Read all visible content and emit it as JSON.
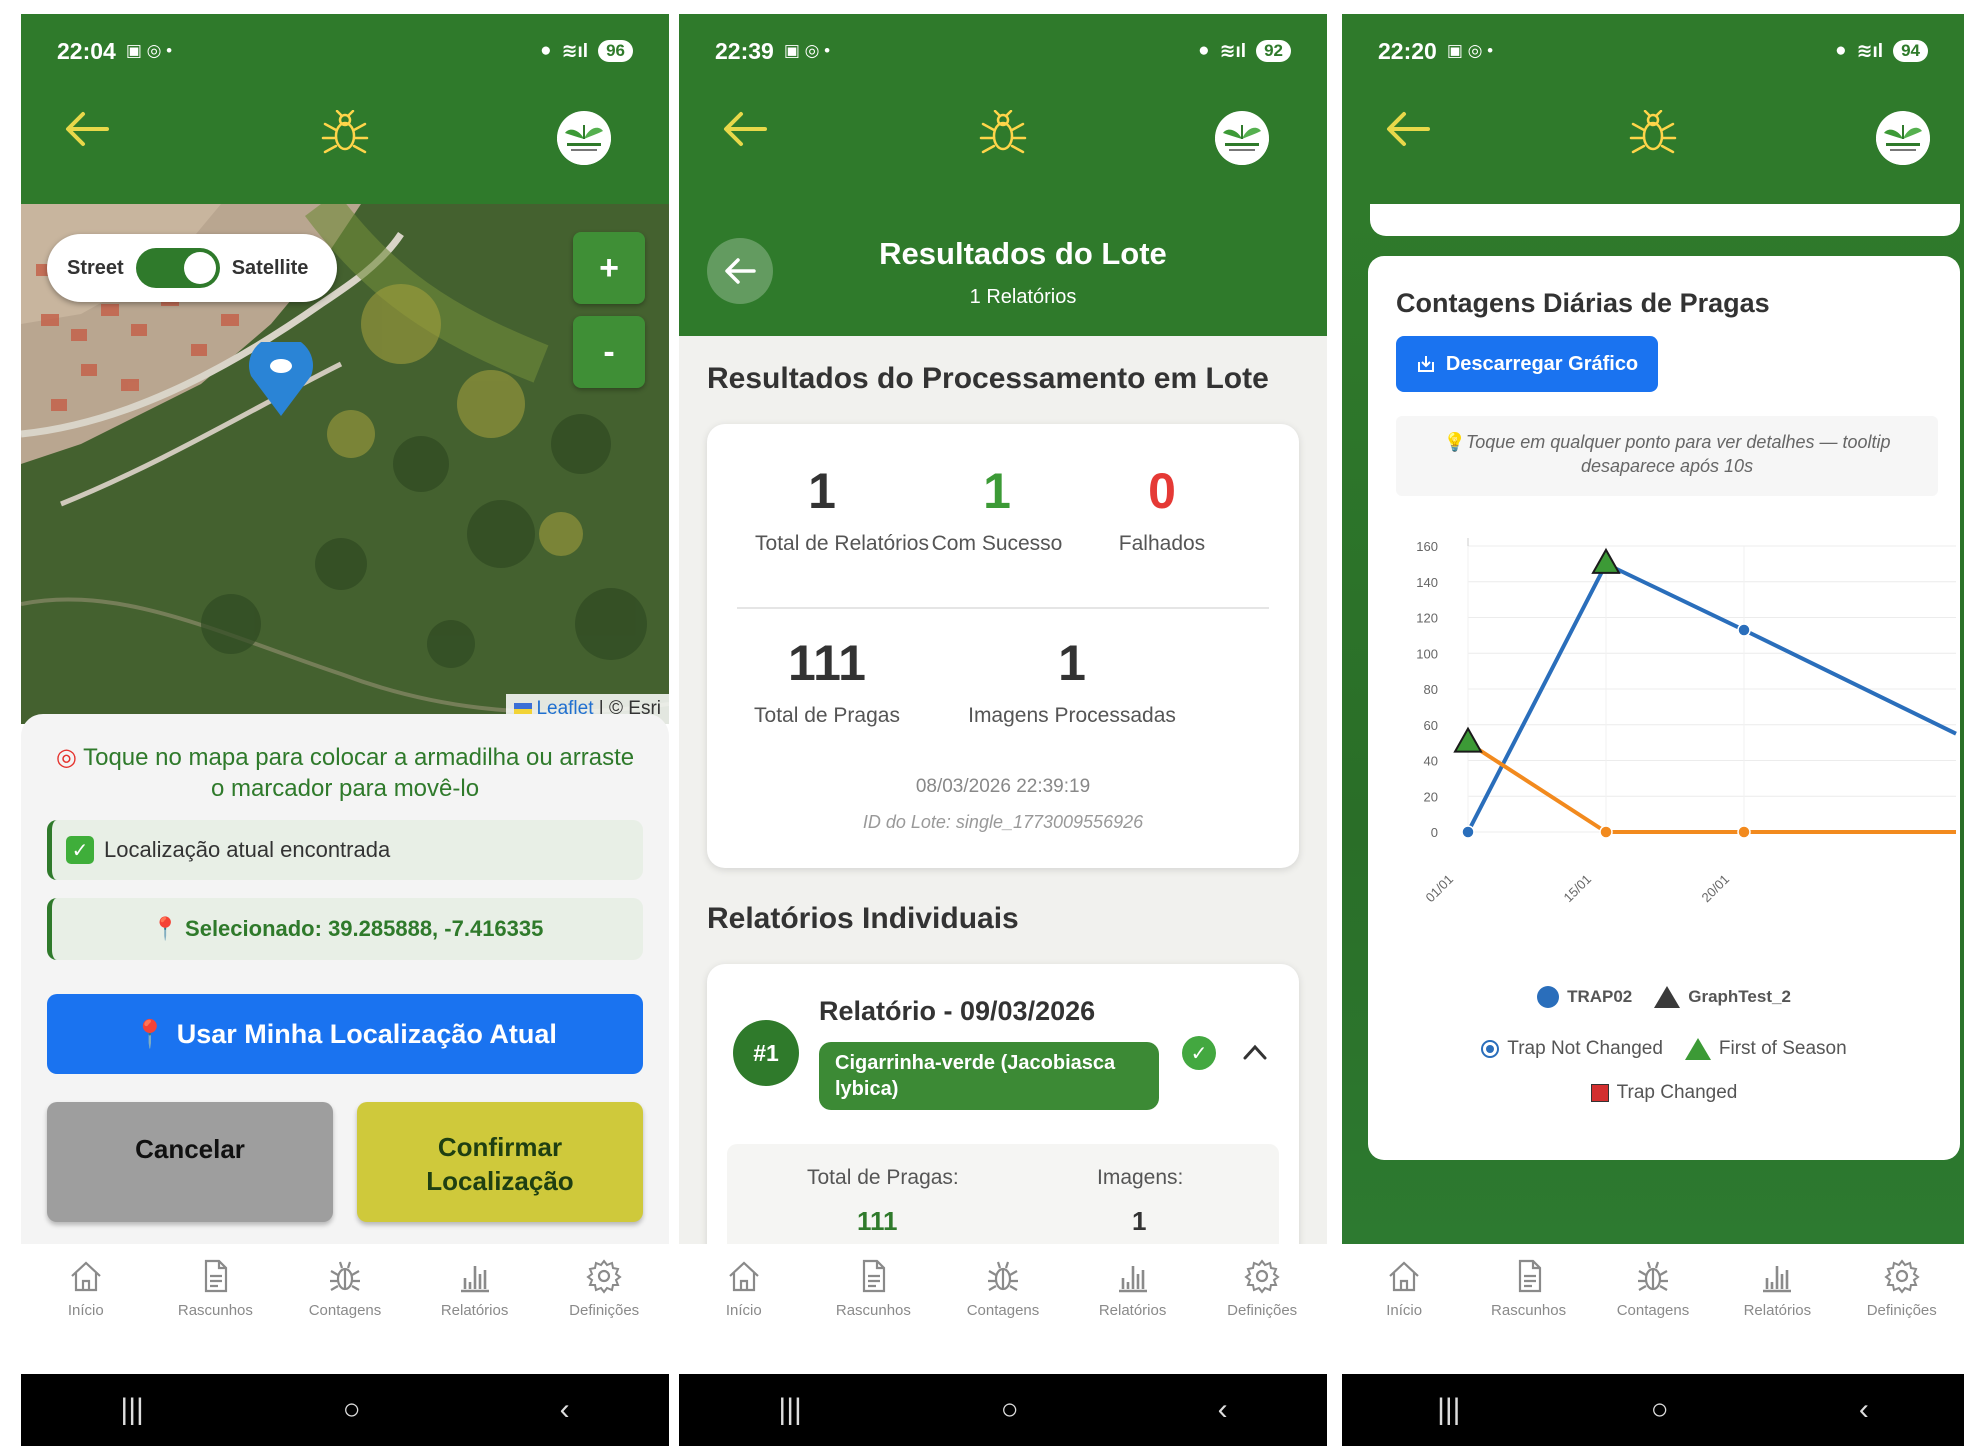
{
  "colors": {
    "brand_green": "#2f7a2b",
    "accent_blue": "#1a73f0",
    "confirm_yellow": "#cfc93b",
    "series_blue": "#2a6ebb",
    "series_orange": "#f28a1e",
    "success_green": "#3c9a36",
    "fail_red": "#e53935"
  },
  "bottom_nav": {
    "items": [
      {
        "label": "Início",
        "icon": "home-icon"
      },
      {
        "label": "Rascunhos",
        "icon": "document-icon"
      },
      {
        "label": "Contagens",
        "icon": "bug-icon"
      },
      {
        "label": "Relatórios",
        "icon": "bar-chart-icon"
      },
      {
        "label": "Definições",
        "icon": "gear-icon"
      }
    ]
  },
  "screen1": {
    "status": {
      "time": "22:04",
      "battery": "96"
    },
    "map": {
      "toggle_left": "Street",
      "toggle_right": "Satellite",
      "zoom_in": "+",
      "zoom_out": "-",
      "attrib_leaflet": "Leaflet",
      "attrib_sep": " | © Esri"
    },
    "hint": "Toque no mapa para colocar a armadilha ou arraste o marcador para movê-lo",
    "found_text": "Localização atual encontrada",
    "selected_text": "Selecionado: 39.285888, -7.416335",
    "use_location_btn": "Usar Minha Localização Atual",
    "cancel_btn": "Cancelar",
    "confirm_btn_line1": "Confirmar",
    "confirm_btn_line2": "Localização"
  },
  "screen2": {
    "status": {
      "time": "22:39",
      "battery": "92"
    },
    "header_title": "Resultados do Lote",
    "header_sub": "1 Relatórios",
    "section1_title": "Resultados do Processamento em Lote",
    "stats": {
      "total_reports": "1",
      "total_reports_lbl": "Total de Relatórios",
      "success": "1",
      "success_lbl": "Com Sucesso",
      "failed": "0",
      "failed_lbl": "Falhados",
      "total_pests": "111",
      "total_pests_lbl": "Total de Pragas",
      "images": "1",
      "images_lbl": "Imagens Processadas"
    },
    "batch_date": "08/03/2026 22:39:19",
    "batch_id": "ID do Lote: single_1773009556926",
    "section2_title": "Relatórios Individuais",
    "report": {
      "badge": "#1",
      "title": "Relatório - 09/03/2026",
      "species": "Cigarrinha-verde (Jacobiasca lybica)",
      "pests_lbl": "Total de Pragas:",
      "pests_val": "111",
      "images_lbl": "Imagens:",
      "images_val": "1"
    }
  },
  "screen3": {
    "status": {
      "time": "22:20",
      "battery": "94"
    },
    "card_title": "Contagens Diárias de Pragas",
    "download_btn": "Descarregar Gráfico",
    "tip": "Toque em qualquer ponto para ver detalhes — tooltip desaparece após 10s",
    "legend": {
      "series1": "TRAP02",
      "series2": "GraphTest_2",
      "marker1": "Trap Not Changed",
      "marker2": "First of Season",
      "marker3": "Trap Changed"
    }
  },
  "chart_data": {
    "type": "line",
    "title": "Contagens Diárias de Pragas",
    "xlabel": "",
    "ylabel": "",
    "x_ticks": [
      "01/01",
      "15/01",
      "20/01"
    ],
    "ylim": [
      0,
      160
    ],
    "y_ticks": [
      0,
      20,
      40,
      60,
      80,
      100,
      120,
      140,
      160
    ],
    "grid": true,
    "legend_position": "bottom",
    "series": [
      {
        "name": "TRAP02",
        "color": "#2a6ebb",
        "points": [
          {
            "x": "01/01",
            "y": 0,
            "marker": "circle"
          },
          {
            "x": "15/01",
            "y": 150,
            "marker": "triangle"
          },
          {
            "x": "20/01",
            "y": 113,
            "marker": "circle"
          },
          {
            "x": "end",
            "y": 55,
            "marker": "none"
          }
        ]
      },
      {
        "name": "GraphTest_2",
        "color": "#f28a1e",
        "points": [
          {
            "x": "01/01",
            "y": 50,
            "marker": "triangle"
          },
          {
            "x": "15/01",
            "y": 0,
            "marker": "circle"
          },
          {
            "x": "20/01",
            "y": 0,
            "marker": "circle"
          },
          {
            "x": "end",
            "y": 0,
            "marker": "none"
          }
        ]
      }
    ]
  }
}
